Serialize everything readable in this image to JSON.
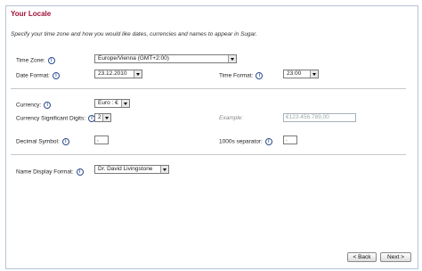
{
  "page": {
    "title": "Your Locale",
    "intro": "Specify your time zone and how you would like dates, currencies and names to appear in Sugar."
  },
  "fields": {
    "time_zone": {
      "label": "Time Zone:",
      "value": "Europe/Vienna (GMT+2:00)"
    },
    "date_format": {
      "label": "Date Format:",
      "value": "23.12.2010"
    },
    "time_format": {
      "label": "Time Format:",
      "value": "23:00"
    },
    "currency": {
      "label": "Currency:",
      "value": "Euro : €"
    },
    "currency_digits": {
      "label": "Currency Significant Digits:",
      "value": "2"
    },
    "example": {
      "label": "Example:",
      "value": "€123.456.789,00"
    },
    "decimal_symbol": {
      "label": "Decimal Symbol:",
      "value": ","
    },
    "thousands_sep": {
      "label": "1000s separator:",
      "value": "."
    },
    "name_display": {
      "label": "Name Display Format:",
      "value": "Dr. David Livingstone"
    }
  },
  "info_glyph": "i",
  "icons": {
    "info": "info-icon",
    "dropdown": "chevron-down-icon"
  },
  "buttons": {
    "back": "< Back",
    "next": "Next >"
  },
  "colors": {
    "title": "#a0103b",
    "frame_border": "#b7c4d4"
  }
}
